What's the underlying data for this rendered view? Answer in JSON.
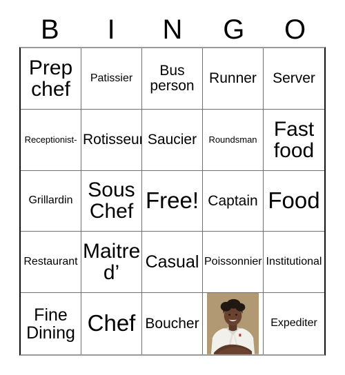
{
  "card": {
    "header_letters": [
      "B",
      "I",
      "N",
      "G",
      "O"
    ],
    "columns": 5,
    "rows": 5,
    "free_space_label": "Free!",
    "border_color": "#111111",
    "grid_line_color": "#6f6f6f",
    "background_color": "#ffffff",
    "text_color": "#000000"
  },
  "cells": [
    {
      "text": "Prep\nchef",
      "size": "t-xl",
      "kind": "text"
    },
    {
      "text": "Patissier",
      "size": "t-sm",
      "kind": "text"
    },
    {
      "text": "Bus\nperson",
      "size": "t-md",
      "kind": "text"
    },
    {
      "text": "Runner",
      "size": "t-md",
      "kind": "text"
    },
    {
      "text": "Server",
      "size": "t-md",
      "kind": "text"
    },
    {
      "text": "Receptionist-",
      "size": "t-xs",
      "kind": "text"
    },
    {
      "text": "Rotisseur",
      "size": "t-md",
      "kind": "text"
    },
    {
      "text": "Saucier",
      "size": "t-md",
      "kind": "text"
    },
    {
      "text": "Roundsman",
      "size": "t-xs",
      "kind": "text"
    },
    {
      "text": "Fast\nfood",
      "size": "t-xl",
      "kind": "text"
    },
    {
      "text": "Grillardin",
      "size": "t-sm",
      "kind": "text"
    },
    {
      "text": "Sous\nChef",
      "size": "t-xl",
      "kind": "text"
    },
    {
      "text": "Free!",
      "size": "t-xxl",
      "kind": "free"
    },
    {
      "text": "Captain",
      "size": "t-md",
      "kind": "text"
    },
    {
      "text": "Food",
      "size": "t-xxl",
      "kind": "text"
    },
    {
      "text": "Restaurant",
      "size": "t-sm",
      "kind": "text"
    },
    {
      "text": "Maitre\nd’",
      "size": "t-xl",
      "kind": "text"
    },
    {
      "text": "Casual",
      "size": "t-lg",
      "kind": "text"
    },
    {
      "text": "Poissonnier",
      "size": "t-sm",
      "kind": "text"
    },
    {
      "text": "Institutional",
      "size": "t-sm",
      "kind": "text"
    },
    {
      "text": "Fine\nDining",
      "size": "t-lg",
      "kind": "text"
    },
    {
      "text": "Chef",
      "size": "t-xxl",
      "kind": "text"
    },
    {
      "text": "Boucher",
      "size": "t-md",
      "kind": "text"
    },
    {
      "text": "",
      "size": "t-sm",
      "kind": "image",
      "image": {
        "name": "chef-portrait",
        "description": "Smiling chef with arms crossed wearing a white chef coat",
        "backdrop_color": "#bda47c",
        "coat_color": "#f2f0ea",
        "skin_color": "#6b4230",
        "hair_color": "#221812"
      }
    },
    {
      "text": "Expediter",
      "size": "t-sm",
      "kind": "text"
    }
  ]
}
